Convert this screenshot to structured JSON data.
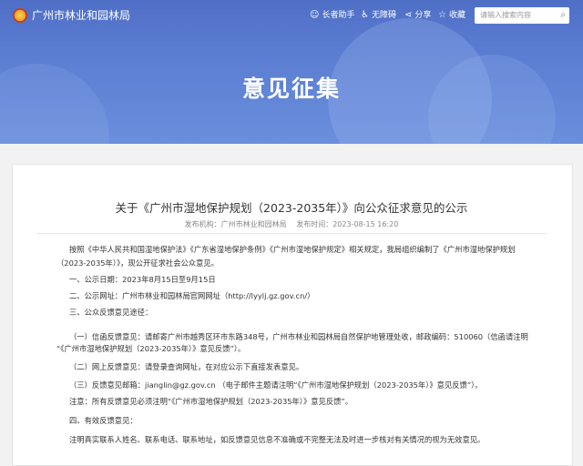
{
  "header": {
    "site_title": "广州市林业和园林局",
    "tools": [
      {
        "icon": "elder-assist-icon",
        "label": "长者助手"
      },
      {
        "icon": "accessibility-icon",
        "label": "无障碍"
      },
      {
        "icon": "share-icon",
        "label": "分享"
      },
      {
        "icon": "star-icon",
        "label": "收藏"
      }
    ],
    "search_placeholder": "请输入搜索内容"
  },
  "banner": {
    "heading": "意见征集"
  },
  "article": {
    "title": "关于《广州市湿地保护规划（2023-2035年）》向公众征求意见的公示",
    "publisher": "发布机构：广州市林业和园林局",
    "publish_time": "发布时间：2023-08-15 16:20",
    "paragraphs": [
      "按照《中华人民共和国湿地保护法》《广东省湿地保护条例》《广州市湿地保护规定》相关规定，我局组织编制了《广州市湿地保护规划",
      "（2023-2035年）》，现公开征求社会公众意见。",
      "一、公示日期：2023年8月15日至9月15日",
      "二、公示网址：广州市林业和园林局官网网址（http://lyylj.gz.gov.cn/）",
      "三、公众反馈意见途径：",
      "（一）信函反馈意见：请邮寄广州市越秀区环市东路348号，广州市林业和园林局自然保护地管理处收，邮政编码：510060（信函请注明",
      "“《广州市湿地保护规划（2023-2035年）》意见反馈”）。",
      "（二）网上反馈意见：请登录查询网址，在对应公示下直接发表意见。",
      "（三）反馈意见邮箱：jianglin@gz.gov.cn （电子邮件主题请注明“《广州市湿地保护规划（2023-2035年）》意见反馈”）。",
      "注意：所有反馈意见必须注明“《广州市湿地保护规划（2023-2035年）》意见反馈”。",
      "四、有效反馈意见：",
      "注明真实联系人姓名、联系电话、联系地址，如反馈意见信息不准确或不完整无法及时进一步核对有关情况的视为无效意见。"
    ]
  }
}
